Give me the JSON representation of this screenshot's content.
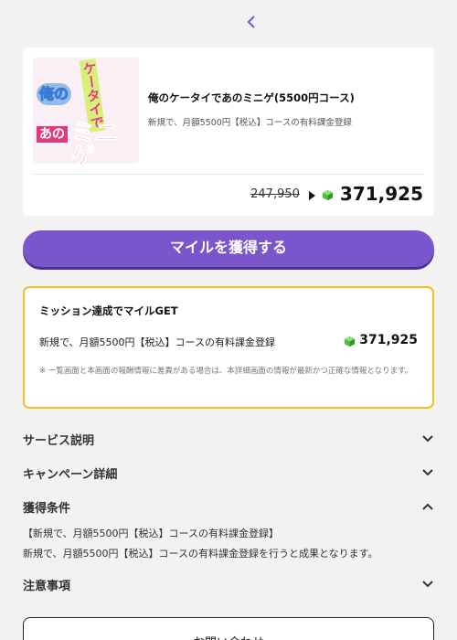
{
  "nav": {
    "back_icon": "chevron-left-icon",
    "accent": "#7b55cc"
  },
  "offer": {
    "title": "俺のケータイであのミニゲ(5500円コース)",
    "subtitle": "新規で、月額5500円【税込】コースの有料課金登録",
    "old_price": "247,950",
    "new_price": "371,925",
    "thumbnail_words": [
      "俺の",
      "ケータイで",
      "あの",
      "ミニゲ"
    ]
  },
  "cta": {
    "label": "マイルを獲得する",
    "color": "#7b55cc"
  },
  "mission": {
    "title": "ミッション達成でマイルGET",
    "description": "新規で、月額5500円【税込】コースの有料課金登録",
    "reward": "371,925",
    "note": "※ 一覧画面と本画面の報酬情報に差異がある場合は、本詳細画面の情報が最新かつ正確な情報となります。",
    "border_color": "#f1c21b"
  },
  "sections": {
    "service": {
      "label": "サービス説明",
      "icon": "chevron-down-icon"
    },
    "campaign": {
      "label": "キャンペーン詳細",
      "icon": "chevron-down-icon"
    },
    "conditions": {
      "label": "獲得条件",
      "icon": "chevron-up-icon",
      "line1": "【新規で、月額5500円【税込】コースの有料課金登録】",
      "line2": "新規で、月額5500円【税込】コースの有料課金登録を行うと成果となります。"
    },
    "notes": {
      "label": "注意事項",
      "icon": "chevron-down-icon"
    }
  },
  "contact": {
    "label": "お問い合わせ"
  }
}
